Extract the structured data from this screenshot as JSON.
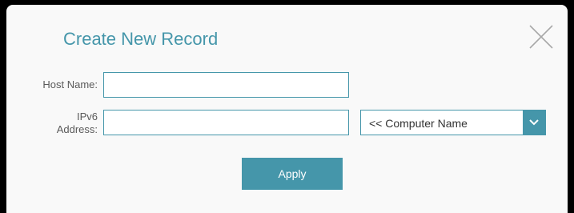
{
  "dialog": {
    "title": "Create New Record",
    "close_icon": "close-icon"
  },
  "form": {
    "host_name_label": "Host Name:",
    "host_name_value": "",
    "ipv6_label_line1": "IPv6",
    "ipv6_label_line2": "Address:",
    "ipv6_value": "",
    "computer_select": {
      "selected": "<< Computer Name",
      "arrow_icon": "chevron-down-icon"
    },
    "apply_label": "Apply"
  },
  "colors": {
    "accent": "#4596aa",
    "background": "#f9f9f9",
    "label_text": "#5a5a5a"
  }
}
